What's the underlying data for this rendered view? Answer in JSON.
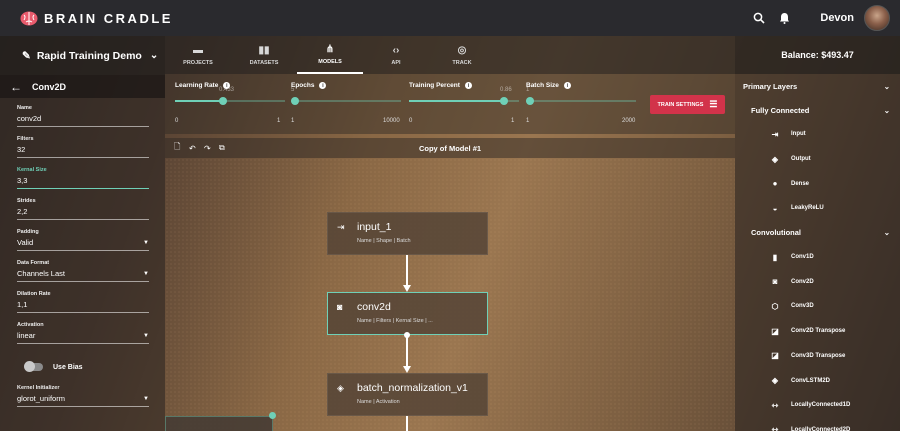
{
  "app": {
    "name": "BRAIN CRADLE",
    "user": "Devon"
  },
  "project": {
    "name": "Rapid Training Demo"
  },
  "nav": {
    "tabs": [
      {
        "label": "PROJECTS",
        "icon": "folder-icon"
      },
      {
        "label": "DATASETS",
        "icon": "bar-chart-icon"
      },
      {
        "label": "MODELS",
        "icon": "hub-icon",
        "active": true
      },
      {
        "label": "API",
        "icon": "code-icon"
      },
      {
        "label": "TRACK",
        "icon": "track-icon"
      }
    ]
  },
  "layer_panel": {
    "title": "Conv2D",
    "fields": [
      {
        "label": "Name",
        "value": "conv2d"
      },
      {
        "label": "Filters",
        "value": "32"
      },
      {
        "label": "Kernal Size",
        "value": "3,3",
        "active": true
      },
      {
        "label": "Strides",
        "value": "2,2"
      },
      {
        "label": "Padding",
        "value": "Valid",
        "dropdown": true
      },
      {
        "label": "Data Format",
        "value": "Channels Last",
        "dropdown": true
      },
      {
        "label": "Dilation Rate",
        "value": "1,1"
      },
      {
        "label": "Activation",
        "value": "linear",
        "dropdown": true
      },
      {
        "label": "Kernel Initializer",
        "value": "glorot_uniform",
        "dropdown": true
      }
    ],
    "use_bias_label": "Use Bias",
    "use_bias": false
  },
  "training": {
    "sliders": [
      {
        "label": "Learning Rate",
        "value": "0.433",
        "min": "0",
        "max": "1",
        "fraction": 0.433
      },
      {
        "label": "Epochs",
        "value": "5",
        "min": "1",
        "max": "10000",
        "fraction": 0.0004
      },
      {
        "label": "Training Percent",
        "value": "0.86",
        "min": "0",
        "max": "1",
        "fraction": 0.86
      },
      {
        "label": "Batch Size",
        "value": "1",
        "min": "1",
        "max": "2000",
        "fraction": 0.0
      }
    ],
    "train_button": "TRAIN SETTINGS"
  },
  "model": {
    "title": "Copy of Model #1",
    "nodes": [
      {
        "name": "input_1",
        "details": "Name | Shape | Batch",
        "icon": "input-icon"
      },
      {
        "name": "conv2d",
        "details": "Name | Filters | Kernal Size | ...",
        "icon": "camera-icon",
        "selected": true
      },
      {
        "name": "batch_normalization_v1",
        "details": "Name | Activation",
        "icon": "layers-icon"
      }
    ]
  },
  "balance": "Balance: $493.47",
  "layer_library": {
    "title": "Primary Layers",
    "groups": [
      {
        "name": "Fully Connected",
        "items": [
          {
            "label": "Input",
            "icon": "input-icon"
          },
          {
            "label": "Output",
            "icon": "layers-icon"
          },
          {
            "label": "Dense",
            "icon": "circle-icon"
          },
          {
            "label": "LeakyReLU",
            "icon": "drop-icon"
          }
        ]
      },
      {
        "name": "Convolutional",
        "items": [
          {
            "label": "Conv1D",
            "icon": "bar-chart-icon"
          },
          {
            "label": "Conv2D",
            "icon": "camera-icon"
          },
          {
            "label": "Conv3D",
            "icon": "cube-icon"
          },
          {
            "label": "Conv2D Transpose",
            "icon": "transpose-icon"
          },
          {
            "label": "Conv3D Transpose",
            "icon": "transpose-icon"
          },
          {
            "label": "ConvLSTM2D",
            "icon": "layers-icon"
          },
          {
            "label": "LocallyConnected1D",
            "icon": "arrows-icon"
          },
          {
            "label": "LocallyConnected2D",
            "icon": "arrows-icon"
          }
        ]
      }
    ]
  }
}
